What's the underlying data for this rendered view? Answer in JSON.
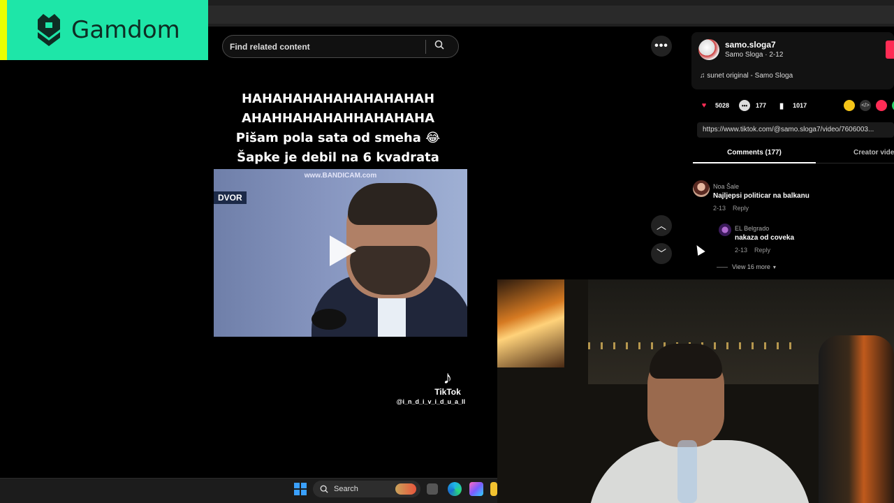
{
  "sponsor": {
    "name": "Gamdom",
    "bg_color": "#1ee6a8",
    "accent_color": "#e9ff00"
  },
  "search": {
    "placeholder": "Find related content",
    "icon": "search-icon"
  },
  "video": {
    "caption_lines": [
      "HAHAHAHAHAHAHAHAHAH",
      "AHAHHAHAHAHHAHAHAHA",
      "Pišam pola sata od smeha 😂",
      "Šapke je debil na 6 kvadrata"
    ],
    "watermark": "www.BANDICAM.com",
    "channel_tag": "DVOR",
    "tiktok_label": "TikTok",
    "tiktok_handle": "@i_n_d_i_v_i_d_u_a_ll",
    "play_icon": "play-icon"
  },
  "controls": {
    "more_icon": "more-icon",
    "more_label": "•••",
    "up_icon": "chevron-up-icon",
    "down_icon": "chevron-down-icon",
    "up_glyph": "︿",
    "down_glyph": "﹀"
  },
  "author": {
    "username": "samo.sloga7",
    "subtitle": "Samo Sloga · 2-12",
    "music": "♫  sunet original - Samo Sloga"
  },
  "stats": {
    "likes": "5028",
    "comments": "177",
    "saves": "1017"
  },
  "link": "https://www.tiktok.com/@samo.sloga7/video/7606003...",
  "tabs": [
    "Comments (177)",
    "Creator vide"
  ],
  "comments": [
    {
      "name": "Noa Šale",
      "text": "Najljepsi politicar na balkanu",
      "date": "2-13",
      "reply": "Reply"
    },
    {
      "name": "EL Belgrado",
      "text": "nakaza od coveka",
      "date": "2-13",
      "reply": "Reply"
    }
  ],
  "view_more": "View 16 more",
  "view_more_icon": "chevron-down-icon",
  "taskbar": {
    "search_label": "Search",
    "start_icon": "windows-start-icon"
  }
}
